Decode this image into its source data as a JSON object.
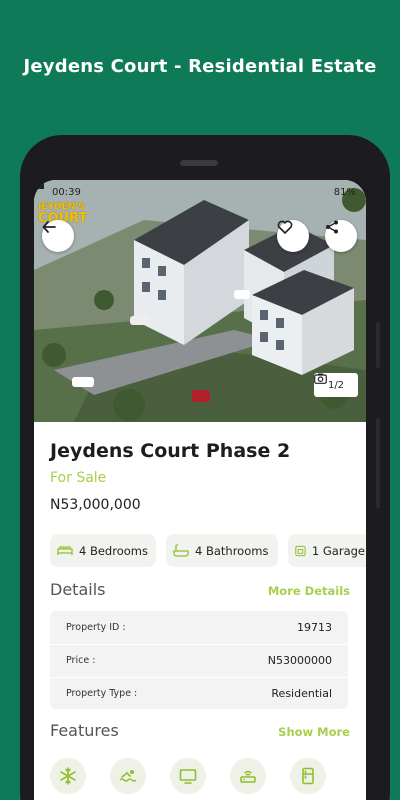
{
  "promo": {
    "title": "Jeydens Court - Residential Estate"
  },
  "status_bar": {
    "time": "00:39",
    "battery": "81%"
  },
  "hero": {
    "logo_line1": "JEYDEN'S",
    "logo_line2": "COURT",
    "photo_counter": "1/2"
  },
  "property": {
    "title": "Jeydens Court Phase 2",
    "status": "For Sale",
    "price": "N53,000,000"
  },
  "chips": [
    {
      "icon": "bed-icon",
      "label": "4 Bedrooms"
    },
    {
      "icon": "bathtub-icon",
      "label": "4 Bathrooms"
    },
    {
      "icon": "garage-icon",
      "label": "1 Garage"
    }
  ],
  "details": {
    "title": "Details",
    "more_link": "More Details",
    "rows": [
      {
        "label": "Property ID :",
        "value": "19713"
      },
      {
        "label": "Price :",
        "value": "N53000000"
      },
      {
        "label": "Property Type :",
        "value": "Residential"
      }
    ]
  },
  "features": {
    "title": "Features",
    "more_link": "Show More",
    "icons": [
      "snowflake-icon",
      "swimming-pool-icon",
      "tv-icon",
      "router-icon",
      "fridge-icon"
    ]
  },
  "colors": {
    "background": "#0e7a58",
    "accent": "#a6cf4a",
    "icon_tint": "#8fbf2e"
  }
}
